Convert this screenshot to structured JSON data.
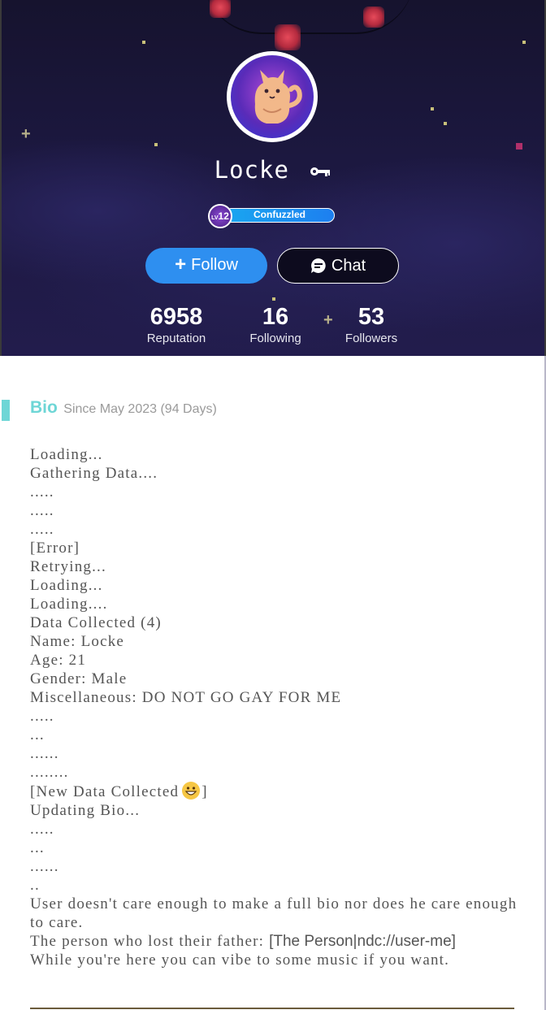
{
  "profile": {
    "name": "Locke",
    "level_badge": {
      "prefix": "LV",
      "number": "12"
    },
    "level_title": "Confuzzled",
    "buttons": {
      "follow": "Follow",
      "chat": "Chat"
    },
    "stats": [
      {
        "value": "6958",
        "label": "Reputation"
      },
      {
        "value": "16",
        "label": "Following"
      },
      {
        "value": "53",
        "label": "Followers"
      }
    ]
  },
  "bio": {
    "heading": "Bio",
    "since": "Since May 2023 (94 Days)",
    "lines": [
      "Loading...",
      "Gathering Data....",
      ".....",
      ".....",
      ".....",
      "[Error]",
      "Retrying...",
      "Loading...",
      "Loading....",
      "Data Collected (4)",
      "Name: Locke",
      "Age: 21",
      "Gender: Male",
      "Miscellaneous: DO NOT GO GAY FOR ME",
      ".....",
      "...",
      "......",
      "........",
      "[New Data Collected",
      "]",
      "Updating Bio...",
      ".....",
      "...",
      "......",
      "..",
      "User doesn't care enough to make a full bio nor does he care enough to care.",
      "The person who lost their father: ",
      "[The Person|ndc://user-me]",
      "While you're here you can vibe to some music if you want."
    ]
  },
  "icons": [
    "key-icon",
    "plus-icon",
    "chat-bubble-icon",
    "grinning-emoji-icon"
  ],
  "colors": {
    "follow": "#2e8ff0",
    "accent": "#6ed6d6",
    "level_bar": "#1aa6f0"
  }
}
